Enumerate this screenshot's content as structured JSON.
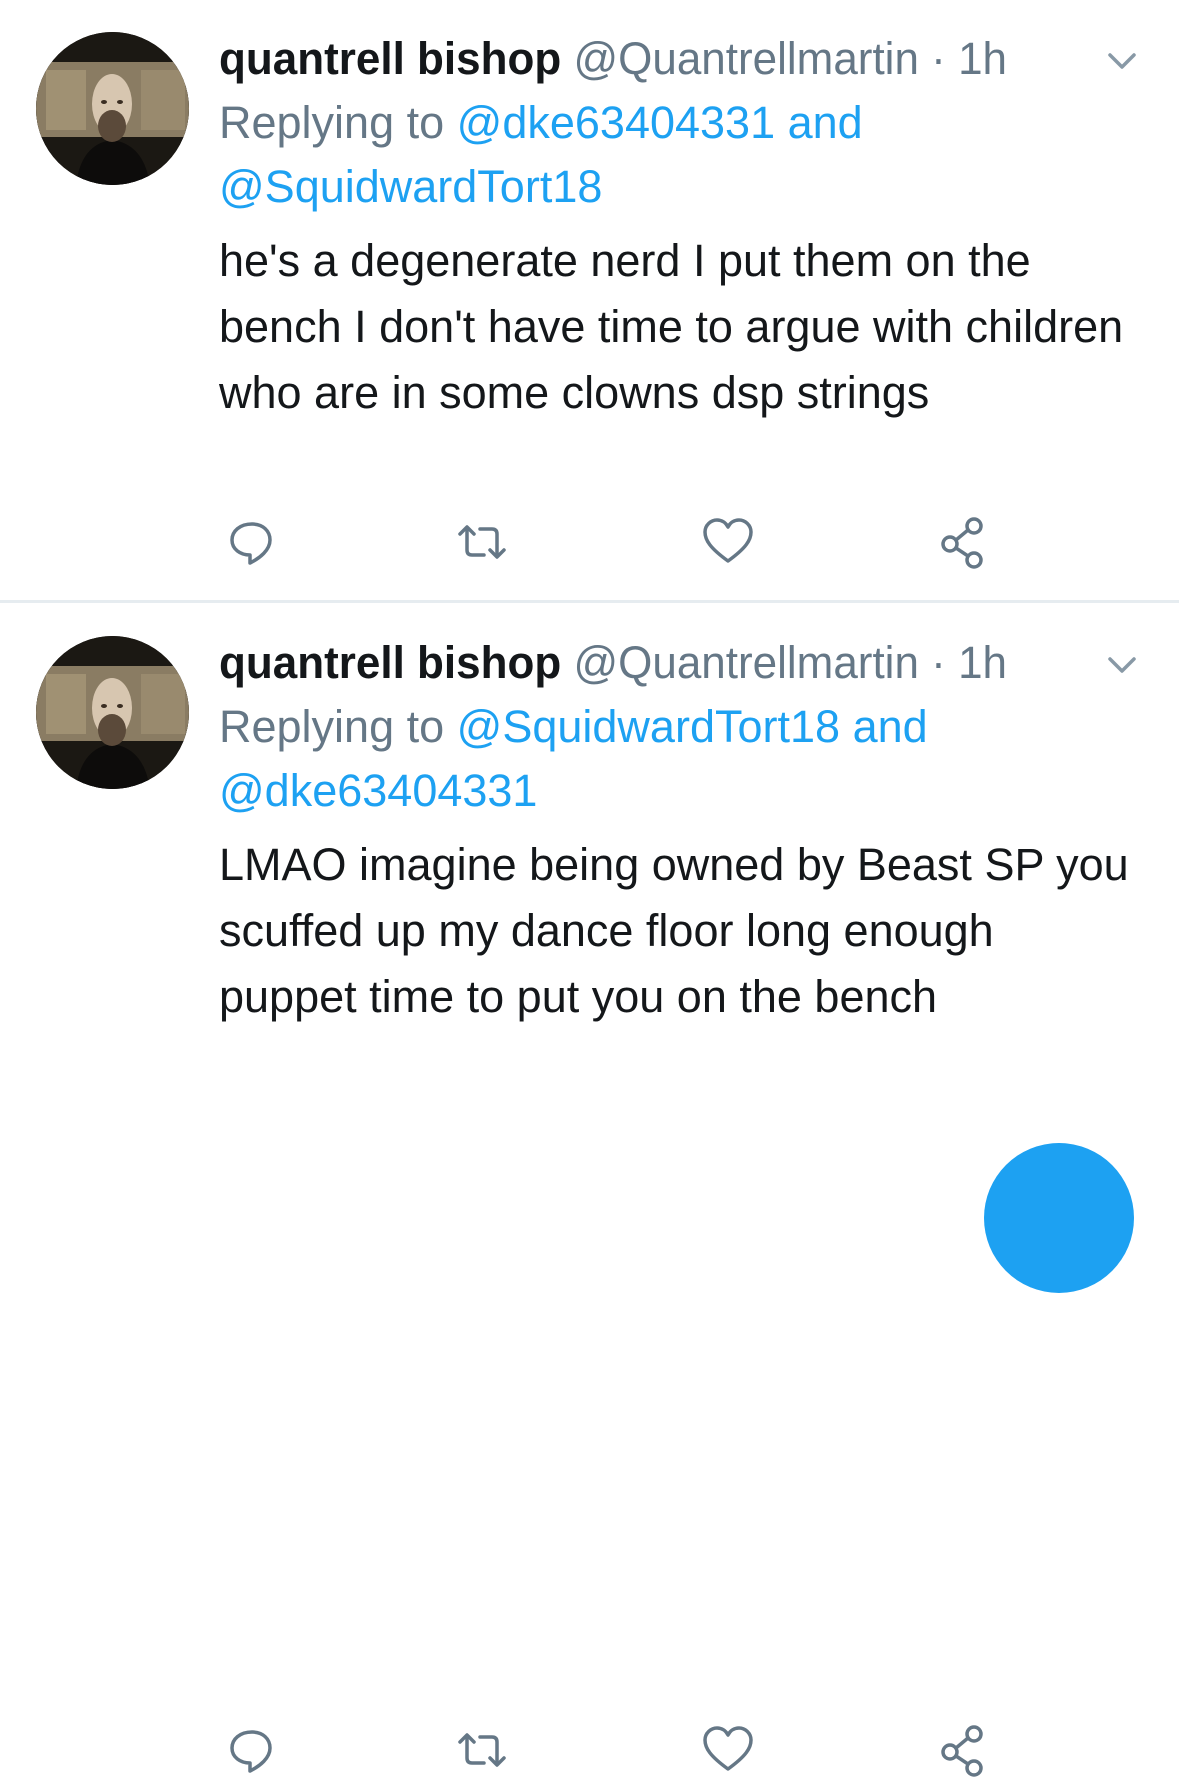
{
  "tweets": [
    {
      "author_name": "quantrell bishop",
      "author_handle": "@Quantrellmartin",
      "separator": "·",
      "time": "1h",
      "replying_prefix": "Replying to",
      "replying_mention_1": "@dke63404331",
      "replying_and": "and",
      "replying_mention_2": "@SquidwardTort18",
      "text": "he's a degenerate nerd I put them on the bench I don't have time to argue with children who are in some clowns dsp strings"
    },
    {
      "author_name": "quantrell bishop",
      "author_handle": "@Quantrellmartin",
      "separator": "·",
      "time": "1h",
      "replying_prefix": "Replying to",
      "replying_mention_1": "@SquidwardTort18",
      "replying_and": "and",
      "replying_mention_2": "@dke63404331",
      "text": "LMAO imagine being owned by Beast SP you scuffed up my dance floor long enough puppet time to put you on the bench"
    }
  ],
  "icons": {
    "reply": "reply-icon",
    "retweet": "retweet-icon",
    "like": "heart-icon",
    "share": "share-icon",
    "menu": "chevron-down-icon",
    "compose": "compose-button"
  },
  "colors": {
    "link": "#1da1f2",
    "secondary_text": "#657786",
    "primary_text": "#14171a",
    "icon": "#657786",
    "divider": "#e6ecf0",
    "fab": "#1da1f2"
  }
}
